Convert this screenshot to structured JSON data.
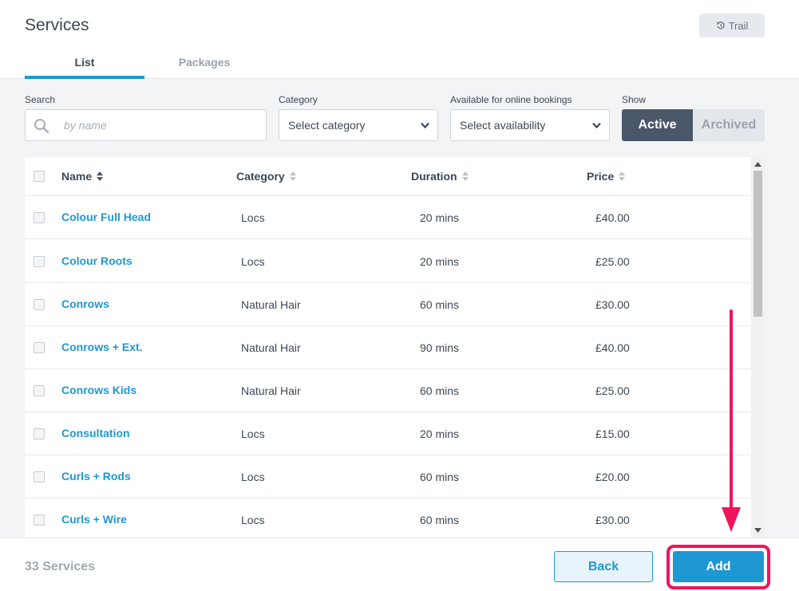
{
  "header": {
    "title": "Services",
    "trail_label": "Trail",
    "tabs": [
      {
        "label": "List",
        "active": true
      },
      {
        "label": "Packages",
        "active": false
      }
    ]
  },
  "filters": {
    "search": {
      "label": "Search",
      "placeholder": "by name",
      "value": ""
    },
    "category": {
      "label": "Category",
      "selected": "Select category"
    },
    "availability": {
      "label": "Available for online bookings",
      "selected": "Select availability"
    },
    "show": {
      "label": "Show",
      "options": [
        "Active",
        "Archived"
      ],
      "selected": "Active"
    }
  },
  "table": {
    "columns": [
      "Name",
      "Category",
      "Duration",
      "Price"
    ],
    "rows": [
      {
        "name": "Colour Full Head",
        "category": "Locs",
        "duration": "20 mins",
        "price": "£40.00"
      },
      {
        "name": "Colour Roots",
        "category": "Locs",
        "duration": "20 mins",
        "price": "£25.00"
      },
      {
        "name": "Conrows",
        "category": "Natural Hair",
        "duration": "60 mins",
        "price": "£30.00"
      },
      {
        "name": "Conrows + Ext.",
        "category": "Natural Hair",
        "duration": "90 mins",
        "price": "£40.00"
      },
      {
        "name": "Conrows Kids",
        "category": "Natural Hair",
        "duration": "60 mins",
        "price": "£25.00"
      },
      {
        "name": "Consultation",
        "category": "Locs",
        "duration": "20 mins",
        "price": "£15.00"
      },
      {
        "name": "Curls + Rods",
        "category": "Locs",
        "duration": "60 mins",
        "price": "£20.00"
      },
      {
        "name": "Curls + Wire",
        "category": "Locs",
        "duration": "60 mins",
        "price": "£30.00"
      }
    ]
  },
  "footer": {
    "count_label": "33 Services",
    "back_label": "Back",
    "add_label": "Add"
  },
  "colors": {
    "accent": "#1e98d3",
    "annotation": "#f0155c",
    "toggle_active_bg": "#4a5768"
  },
  "icons": [
    "trail-icon",
    "search-icon",
    "chevron-down-icon",
    "sort-icon",
    "annotation-arrow"
  ]
}
